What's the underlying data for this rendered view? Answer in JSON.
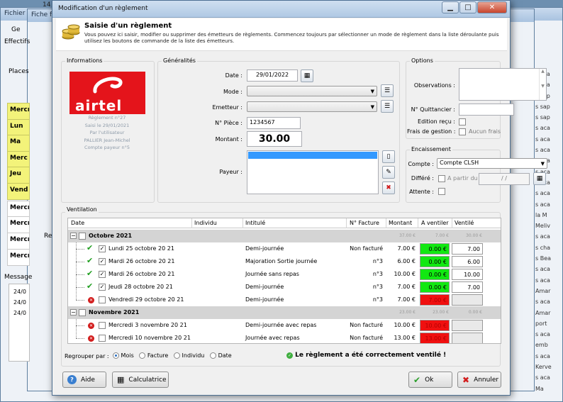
{
  "background": {
    "win1_title": "Fichier",
    "win2_title": "Fiche f",
    "top_title": "14",
    "left_labels": [
      "Ge",
      "Effectifs",
      "Places",
      "Re",
      "Message"
    ],
    "days": [
      "Mercr",
      "Lun",
      "Ma",
      "Merc",
      "Jeu",
      "Vend",
      "Mercr",
      "Mercr",
      "Mercr",
      "Mercr"
    ],
    "msg_lines": [
      "24/0",
      "24/0",
      "24/0"
    ],
    "right_list": [
      "s aza",
      "s aza",
      "s sap",
      "s sap",
      "s sap",
      "s aca",
      "s aca",
      "s aca",
      "s aca",
      "s aca",
      "s aca",
      "s aca",
      "s aca",
      "la M",
      "Meliv",
      "s aca",
      "s cha",
      "s Bea",
      "s aca",
      "s aca",
      "Amar",
      "s aca",
      "Amar",
      "port",
      "s aca",
      "emb",
      "s aca",
      "Kerve",
      "s aca",
      "Ma"
    ]
  },
  "dialog": {
    "title": "Modification d'un règlement",
    "heading": "Saisie d'un règlement",
    "description": "Vous pouvez ici saisir, modifier ou supprimer des émetteurs de règlements. Commencez toujours par sélectionner un mode de règlement dans la liste déroulante puis utilisez les boutons de commande de la liste des émetteurs."
  },
  "informations": {
    "title": "Informations",
    "logo_text": "airtel",
    "lines": [
      "Règlement n°27",
      "Saisi le 29/01/2021",
      "Par l'utilisateur",
      "PALLIER Jean-Michel",
      "Compte payeur n°5"
    ]
  },
  "generalites": {
    "title": "Généralités",
    "date_label": "Date :",
    "date_value": "29/01/2022",
    "mode_label": "Mode :",
    "mode_value": "",
    "emetteur_label": "Emetteur :",
    "emetteur_value": "",
    "piece_label": "N° Pièce :",
    "piece_value": "1234567",
    "montant_label": "Montant :",
    "montant_value": "30.00",
    "payeur_label": "Payeur :"
  },
  "options": {
    "title": "Options",
    "observations_label": "Observations :",
    "quittancier_label": "N° Quittancier :",
    "edition_label": "Edition reçu :",
    "frais_label": "Frais de gestion :",
    "frais_value": "Aucun frais"
  },
  "encaissement": {
    "title": "Encaissement",
    "compte_label": "Compte :",
    "compte_value": "Compte CLSH",
    "differe_label": "Différé :",
    "a_partir_du": "A partir du",
    "date_placeholder": "/   /",
    "attente_label": "Attente :"
  },
  "ventilation": {
    "title": "Ventilation",
    "columns": [
      "Date",
      "Individu",
      "Intitulé",
      "N° Facture",
      "Montant",
      "A ventiler",
      "Ventilé"
    ],
    "groups": [
      {
        "label": "Octobre 2021",
        "totals": [
          "37.00 €",
          "7.00 €",
          "30.00 €"
        ],
        "rows": [
          {
            "status": "ok",
            "checked": true,
            "date": "Lundi 25 octobre 20 21",
            "intitule": "Demi-journée",
            "facture": "Non facturé",
            "montant": "7.00 €",
            "a_ventiler": "0.00 €",
            "ventile": "7.00"
          },
          {
            "status": "ok",
            "checked": true,
            "date": "Mardi 26 octobre 20 21",
            "intitule": "Majoration Sortie journée",
            "facture": "n°3",
            "montant": "6.00 €",
            "a_ventiler": "0.00 €",
            "ventile": "6.00"
          },
          {
            "status": "ok",
            "checked": true,
            "date": "Mardi 26 octobre 20 21",
            "intitule": "Journée sans repas",
            "facture": "n°3",
            "montant": "10.00 €",
            "a_ventiler": "0.00 €",
            "ventile": "10.00"
          },
          {
            "status": "ok",
            "checked": true,
            "date": "Jeudi 28 octobre 20 21",
            "intitule": "Demi-journée",
            "facture": "n°3",
            "montant": "7.00 €",
            "a_ventiler": "0.00 €",
            "ventile": "7.00"
          },
          {
            "status": "err",
            "checked": false,
            "date": "Vendredi 29 octobre 20 21",
            "intitule": "Demi-journée",
            "facture": "n°3",
            "montant": "7.00 €",
            "a_ventiler": "7.00 €",
            "ventile": ""
          }
        ]
      },
      {
        "label": "Novembre 2021",
        "totals": [
          "23.00 €",
          "23.00 €",
          "0.00 €"
        ],
        "rows": [
          {
            "status": "err",
            "checked": false,
            "date": "Mercredi 3 novembre 20 21",
            "intitule": "Demi-journée avec repas",
            "facture": "Non facturé",
            "montant": "10.00 €",
            "a_ventiler": "10.00 €",
            "ventile": ""
          },
          {
            "status": "err",
            "checked": false,
            "date": "Mercredi 10 novembre 20 21",
            "intitule": "Journée avec repas",
            "facture": "Non facturé",
            "montant": "13.00 €",
            "a_ventiler": "13.00 €",
            "ventile": ""
          }
        ]
      }
    ],
    "regrouper_label": "Regrouper par :",
    "regrouper_options": [
      "Mois",
      "Facture",
      "Individu",
      "Date"
    ],
    "regrouper_selected": "Mois",
    "status_message": "Le règlement a été correctement ventilé !"
  },
  "buttons": {
    "aide": "Aide",
    "calculatrice": "Calculatrice",
    "ok": "Ok",
    "annuler": "Annuler"
  },
  "colors": {
    "ok_fill": "#12e812",
    "err_fill": "#f01010",
    "logo_red": "#e4141b"
  }
}
